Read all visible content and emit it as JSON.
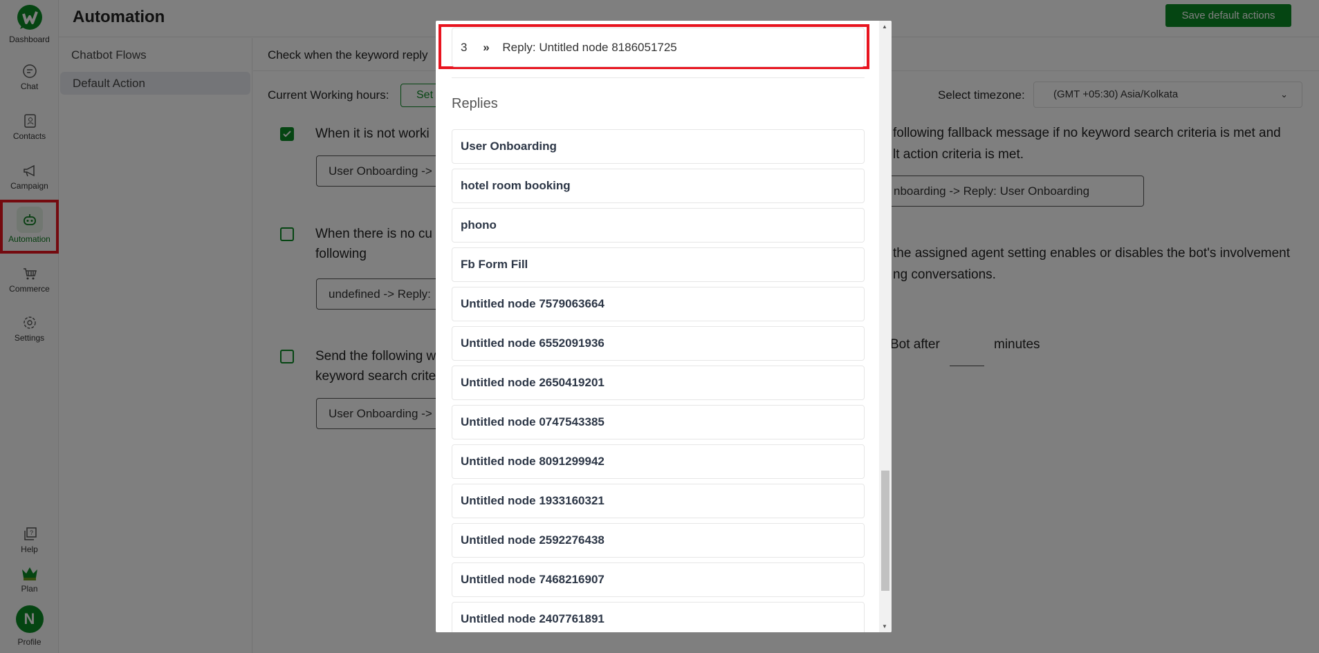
{
  "sidebar": {
    "items": [
      {
        "label": "Dashboard",
        "icon": "logo-icon"
      },
      {
        "label": "Chat",
        "icon": "chat-icon"
      },
      {
        "label": "Contacts",
        "icon": "contacts-icon"
      },
      {
        "label": "Campaign",
        "icon": "megaphone-icon"
      },
      {
        "label": "Automation",
        "icon": "robot-icon",
        "active": true
      },
      {
        "label": "Commerce",
        "icon": "cart-icon"
      },
      {
        "label": "Settings",
        "icon": "gear-icon"
      }
    ],
    "bottom": [
      {
        "label": "Help",
        "icon": "help-icon"
      },
      {
        "label": "Plan",
        "icon": "crown-icon"
      },
      {
        "label": "Profile",
        "avatar": "N"
      }
    ]
  },
  "header": {
    "title": "Automation",
    "save_label": "Save default actions"
  },
  "subnav": {
    "items": [
      "Chatbot Flows",
      "Default Action"
    ]
  },
  "main": {
    "intro": "Check when the keyword reply",
    "working_hours_label": "Current Working hours:",
    "set_button": "Set",
    "timezone_label": "Select timezone:",
    "timezone_value": "(GMT +05:30) Asia/Kolkata",
    "option1": {
      "checked": true,
      "text": "When it is not worki",
      "select": "User Onboarding ->"
    },
    "option2": {
      "checked": false,
      "line1": "When there is no cu",
      "line2": "following",
      "select": "undefined -> Reply:"
    },
    "option3": {
      "checked": false,
      "line1": "Send the following w",
      "line2": "keyword search crite",
      "select": "User Onboarding ->"
    },
    "right1_line1": "following fallback message if no keyword search criteria is met and",
    "right1_line2": "lt action criteria is met.",
    "right1_select": "nboarding -> Reply: User Onboarding",
    "right2_line1": "the assigned agent setting enables or disables the bot's involvement",
    "right2_line2": "ng conversations.",
    "right3_prefix": "Bot after",
    "right3_suffix": "minutes"
  },
  "modal": {
    "selected": {
      "index": "3",
      "sep": "»",
      "label": "Reply: Untitled node 8186051725"
    },
    "replies_heading": "Replies",
    "replies": [
      "User Onboarding",
      "hotel room booking",
      "phono",
      "Fb Form Fill",
      "Untitled node 7579063664",
      "Untitled node 6552091936",
      "Untitled node 2650419201",
      "Untitled node 0747543385",
      "Untitled node 8091299942",
      "Untitled node 1933160321",
      "Untitled node 2592276438",
      "Untitled node 7468216907",
      "Untitled node 2407761891"
    ]
  },
  "colors": {
    "brand": "#0b8a24",
    "highlight": "#e8141f"
  }
}
